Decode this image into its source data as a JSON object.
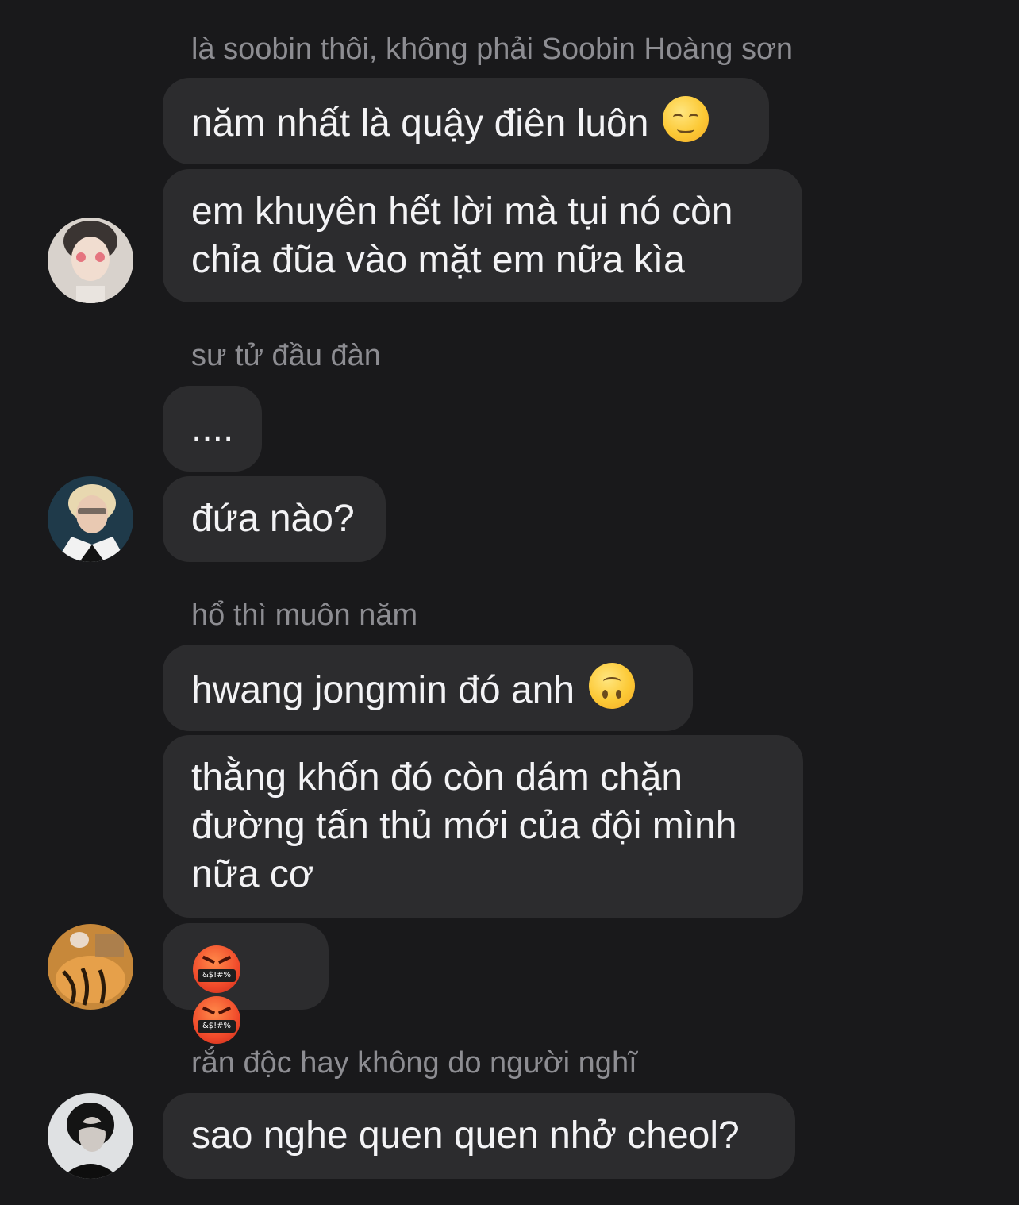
{
  "messages": [
    {
      "type": "sender",
      "text": "là soobin thôi, không phải Soobin Hoàng sơn"
    },
    {
      "type": "bubble",
      "text": "năm nhất là quậy điên luôn",
      "emoji": "relieved-face-icon"
    },
    {
      "type": "bubble",
      "text": "em khuyên hết lời mà tụi nó còn\nchỉa đũa vào mặt em nữa kìa"
    },
    {
      "type": "sender",
      "text": "sư tử đầu đàn"
    },
    {
      "type": "bubble",
      "text": "...."
    },
    {
      "type": "bubble",
      "text": "đứa nào?"
    },
    {
      "type": "sender",
      "text": "hổ thì muôn năm"
    },
    {
      "type": "bubble",
      "text": "hwang jongmin đó anh",
      "emoji": "upside-down-face-icon"
    },
    {
      "type": "bubble",
      "text": "thằng khốn đó còn dám chặn\nđường tấn thủ mới của đội mình\nnữa cơ"
    },
    {
      "type": "bubble",
      "emoji_only": [
        "face-with-symbols-on-mouth-icon",
        "face-with-symbols-on-mouth-icon"
      ],
      "symbol_text": "&$!#%"
    },
    {
      "type": "sender",
      "text": "rắn độc hay không do người nghĩ"
    },
    {
      "type": "bubble",
      "text": "sao nghe quen quen nhở cheol?"
    }
  ],
  "avatars": [
    "avatar-soobin",
    "avatar-lion",
    "avatar-tiger",
    "avatar-snake"
  ],
  "colors": {
    "background": "#19191b",
    "bubble": "#2c2c2e",
    "text": "#f3f3f5",
    "sender": "#8d8d92"
  }
}
